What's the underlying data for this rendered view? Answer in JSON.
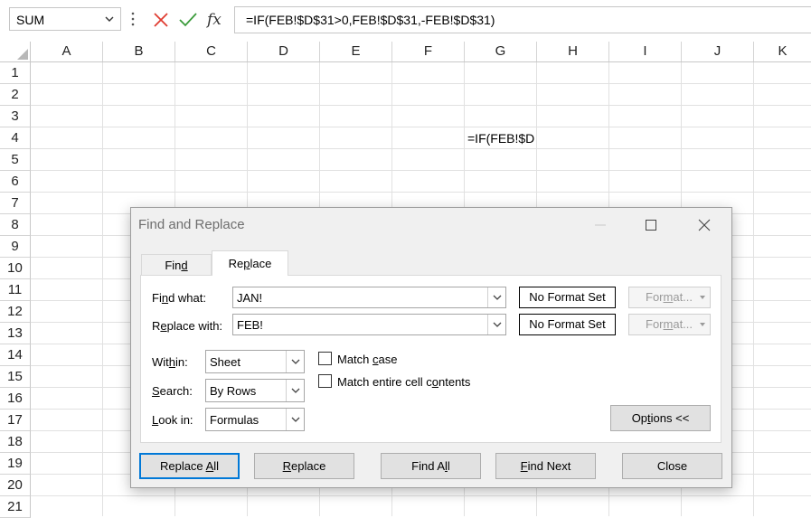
{
  "formula_bar": {
    "name_box": "SUM",
    "formula": "=IF(FEB!$D$31>0,FEB!$D$31,-FEB!$D$31)"
  },
  "columns": [
    "A",
    "B",
    "C",
    "D",
    "E",
    "F",
    "G",
    "H",
    "I",
    "J",
    "K"
  ],
  "rows": [
    "1",
    "2",
    "3",
    "4",
    "5",
    "6",
    "7",
    "8",
    "9",
    "10",
    "11",
    "12",
    "13",
    "14",
    "15",
    "16",
    "17",
    "18",
    "19",
    "20",
    "21"
  ],
  "cells": {
    "G4": "=IF(FEB!$D"
  },
  "dialog": {
    "title": "Find and Replace",
    "tabs": [
      {
        "label_pre": "Fin",
        "label_u": "d",
        "label_post": ""
      },
      {
        "label_pre": "Re",
        "label_u": "p",
        "label_post": "lace"
      }
    ],
    "find_what": {
      "label_pre": "Fi",
      "label_u": "n",
      "label_post": "d what:",
      "value": "JAN!"
    },
    "replace_with": {
      "label_pre": "R",
      "label_u": "e",
      "label_post": "place with:",
      "value": "FEB!"
    },
    "no_format_set": "No Format Set",
    "format_button": {
      "pre": "For",
      "u": "m",
      "post": "at..."
    },
    "within": {
      "label_pre": "Wit",
      "label_u": "h",
      "label_post": "in:",
      "value": "Sheet"
    },
    "search": {
      "label_pre": "",
      "label_u": "S",
      "label_post": "earch:",
      "value": "By Rows"
    },
    "look_in": {
      "label_pre": "",
      "label_u": "L",
      "label_post": "ook in:",
      "value": "Formulas"
    },
    "match_case": {
      "pre": "Match ",
      "u": "c",
      "post": "ase"
    },
    "match_entire": {
      "pre": "Match entire cell c",
      "u": "o",
      "post": "ntents"
    },
    "options": {
      "pre": "Op",
      "u": "t",
      "post": "ions <<"
    },
    "buttons": {
      "replace_all": {
        "pre": "Replace ",
        "u": "A",
        "post": "ll"
      },
      "replace": {
        "pre": "",
        "u": "R",
        "post": "eplace"
      },
      "find_all": {
        "pre": "Find A",
        "u": "l",
        "post": "l"
      },
      "find_next": {
        "pre": "",
        "u": "F",
        "post": "ind Next"
      },
      "close": "Close"
    }
  }
}
